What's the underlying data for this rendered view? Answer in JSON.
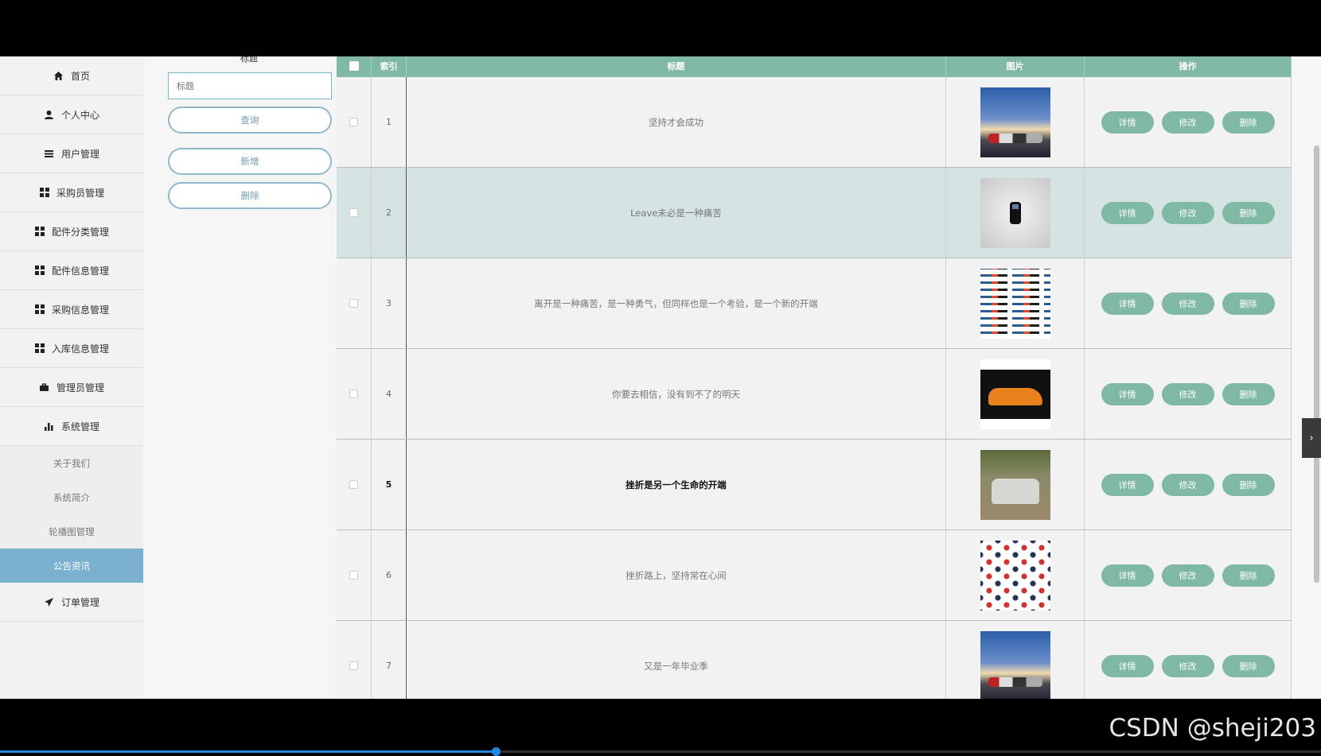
{
  "sidebar": {
    "items": [
      {
        "label": "首页",
        "icon": "home-icon"
      },
      {
        "label": "个人中心",
        "icon": "user-icon"
      },
      {
        "label": "用户管理",
        "icon": "list-icon"
      },
      {
        "label": "采购员管理",
        "icon": "grid-icon"
      },
      {
        "label": "配件分类管理",
        "icon": "grid-icon"
      },
      {
        "label": "配件信息管理",
        "icon": "grid-icon"
      },
      {
        "label": "采购信息管理",
        "icon": "grid-icon"
      },
      {
        "label": "入库信息管理",
        "icon": "grid-icon"
      },
      {
        "label": "管理员管理",
        "icon": "briefcase-icon"
      },
      {
        "label": "系统管理",
        "icon": "bar-chart-icon"
      }
    ],
    "sub_items": [
      {
        "label": "关于我们",
        "active": false
      },
      {
        "label": "系统简介",
        "active": false
      },
      {
        "label": "轮播图管理",
        "active": false
      },
      {
        "label": "公告资讯",
        "active": true
      }
    ],
    "last_item": {
      "label": "订单管理",
      "icon": "send-icon"
    }
  },
  "search": {
    "label": "标题",
    "placeholder": "标题",
    "query_button": "查询",
    "add_button": "新增",
    "delete_button": "删除"
  },
  "table": {
    "headers": [
      "索引",
      "标题",
      "图片",
      "操作"
    ],
    "rows": [
      {
        "index": "1",
        "title": "坚持才会成功"
      },
      {
        "index": "2",
        "title": "Leave未必是一种痛苦"
      },
      {
        "index": "3",
        "title": "离开是一种痛苦，是一种勇气，但同样也是一个考验，是一个新的开端"
      },
      {
        "index": "4",
        "title": "你要去相信，没有到不了的明天"
      },
      {
        "index": "5",
        "title": "挫折是另一个生命的开端"
      },
      {
        "index": "6",
        "title": "挫折路上，坚持常在心间"
      },
      {
        "index": "7",
        "title": "又是一年毕业季"
      }
    ],
    "actions": [
      "详情",
      "修改",
      "删除"
    ]
  },
  "colors": {
    "header_bg": "#7fb8a3",
    "sidebar_active": "#7bb1cf",
    "highlight_row": "#d5e3e2"
  },
  "video": {
    "progress": 0.375
  },
  "watermark": "CSDN @sheji203"
}
